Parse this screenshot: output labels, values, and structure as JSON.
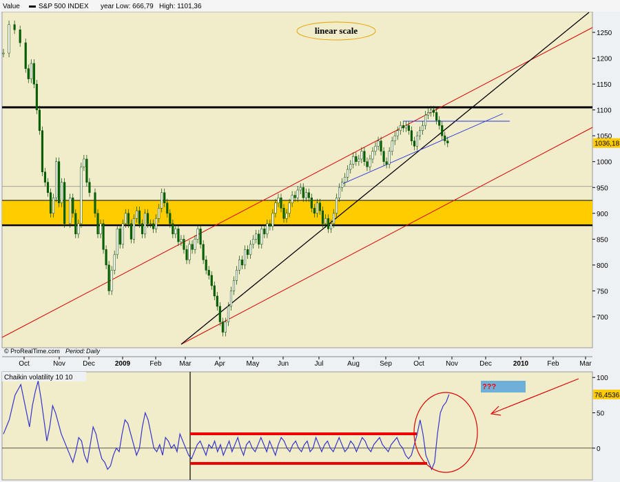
{
  "header": {
    "value_label": "Value",
    "series_name": "S&P 500 INDEX",
    "year_low_label": "year Low: 666,79",
    "high_label": "High: 1101,36"
  },
  "annotations": {
    "scale_note": "linear scale",
    "question": "???",
    "source": "© ProRealTime.com",
    "period_label": "Period:",
    "period_value": "Daily"
  },
  "colors": {
    "panel_bg": "#f1ecca",
    "band": "#ffcc00",
    "price": "#006600",
    "channel": "#dd0000",
    "trend": "#000000",
    "volatility": "#3333cc",
    "value_box": "#ffcc00"
  },
  "chart_data": [
    {
      "type": "line",
      "series": [
        {
          "name": "S&P 500 INDEX"
        }
      ],
      "x_ticks": [
        "Oct",
        "Nov",
        "Dec",
        "2009",
        "Feb",
        "Mar",
        "Apr",
        "May",
        "Jun",
        "Jul",
        "Aug",
        "Sep",
        "Oct",
        "Nov",
        "Dec",
        "2010",
        "Feb",
        "Mar"
      ],
      "y_ticks": [
        700,
        750,
        800,
        850,
        900,
        950,
        1000,
        1050,
        1100,
        1150,
        1200,
        1250
      ],
      "ylim": [
        640,
        1290
      ],
      "last_value": "1036,18",
      "resistance_level": 1105,
      "support_band": [
        877,
        925
      ],
      "reference_level": 952,
      "points": [
        [
          0,
          1210
        ],
        [
          2,
          1265
        ],
        [
          4,
          1255
        ],
        [
          6,
          1230
        ],
        [
          8,
          1180
        ],
        [
          9,
          1160
        ],
        [
          10,
          1190
        ],
        [
          11,
          1150
        ],
        [
          12,
          1100
        ],
        [
          13,
          1060
        ],
        [
          14,
          980
        ],
        [
          15,
          960
        ],
        [
          16,
          940
        ],
        [
          17,
          900
        ],
        [
          18,
          930
        ],
        [
          19,
          1000
        ],
        [
          20,
          920
        ],
        [
          21,
          960
        ],
        [
          22,
          880
        ],
        [
          24,
          930
        ],
        [
          25,
          900
        ],
        [
          26,
          860
        ],
        [
          27,
          880
        ],
        [
          28,
          990
        ],
        [
          29,
          1005
        ],
        [
          30,
          960
        ],
        [
          31,
          940
        ],
        [
          33,
          900
        ],
        [
          34,
          860
        ],
        [
          35,
          880
        ],
        [
          36,
          830
        ],
        [
          37,
          800
        ],
        [
          38,
          750
        ],
        [
          39,
          790
        ],
        [
          40,
          820
        ],
        [
          41,
          870
        ],
        [
          42,
          840
        ],
        [
          43,
          880
        ],
        [
          44,
          900
        ],
        [
          45,
          880
        ],
        [
          46,
          850
        ],
        [
          47,
          890
        ],
        [
          48,
          905
        ],
        [
          49,
          880
        ],
        [
          50,
          860
        ],
        [
          51,
          900
        ],
        [
          52,
          880
        ],
        [
          53,
          880
        ],
        [
          54,
          870
        ],
        [
          55,
          890
        ],
        [
          56,
          910
        ],
        [
          57,
          940
        ],
        [
          58,
          920
        ],
        [
          59,
          900
        ],
        [
          60,
          880
        ],
        [
          61,
          860
        ],
        [
          62,
          870
        ],
        [
          63,
          845
        ],
        [
          64,
          850
        ],
        [
          65,
          830
        ],
        [
          66,
          810
        ],
        [
          67,
          840
        ],
        [
          68,
          830
        ],
        [
          69,
          850
        ],
        [
          70,
          870
        ],
        [
          71,
          840
        ],
        [
          72,
          810
        ],
        [
          73,
          790
        ],
        [
          74,
          780
        ],
        [
          75,
          760
        ],
        [
          76,
          740
        ],
        [
          77,
          720
        ],
        [
          78,
          690
        ],
        [
          79,
          670
        ],
        [
          80,
          690
        ],
        [
          81,
          720
        ],
        [
          82,
          750
        ],
        [
          83,
          770
        ],
        [
          84,
          790
        ],
        [
          85,
          810
        ],
        [
          86,
          800
        ],
        [
          87,
          830
        ],
        [
          88,
          820
        ],
        [
          89,
          840
        ],
        [
          90,
          850
        ],
        [
          91,
          860
        ],
        [
          92,
          840
        ],
        [
          93,
          870
        ],
        [
          94,
          860
        ],
        [
          95,
          880
        ],
        [
          96,
          875
        ],
        [
          97,
          900
        ],
        [
          98,
          920
        ],
        [
          99,
          930
        ],
        [
          100,
          910
        ],
        [
          101,
          890
        ],
        [
          102,
          900
        ],
        [
          103,
          920
        ],
        [
          104,
          935
        ],
        [
          105,
          930
        ],
        [
          106,
          945
        ],
        [
          107,
          950
        ],
        [
          108,
          930
        ],
        [
          109,
          940
        ],
        [
          110,
          930
        ],
        [
          111,
          910
        ],
        [
          112,
          900
        ],
        [
          113,
          920
        ],
        [
          114,
          905
        ],
        [
          115,
          880
        ],
        [
          116,
          890
        ],
        [
          117,
          870
        ],
        [
          118,
          880
        ],
        [
          119,
          900
        ],
        [
          120,
          930
        ],
        [
          121,
          950
        ],
        [
          122,
          960
        ],
        [
          123,
          970
        ],
        [
          124,
          985
        ],
        [
          125,
          995
        ],
        [
          126,
          1010
        ],
        [
          127,
          1000
        ],
        [
          128,
          1005
        ],
        [
          129,
          1020
        ],
        [
          130,
          1000
        ],
        [
          131,
          990
        ],
        [
          132,
          1005
        ],
        [
          133,
          1020
        ],
        [
          134,
          1030
        ],
        [
          135,
          1040
        ],
        [
          136,
          1020
        ],
        [
          137,
          1000
        ],
        [
          138,
          995
        ],
        [
          139,
          1020
        ],
        [
          140,
          1040
        ],
        [
          141,
          1050
        ],
        [
          142,
          1060
        ],
        [
          143,
          1070
        ],
        [
          144,
          1065
        ],
        [
          145,
          1070
        ],
        [
          146,
          1060
        ],
        [
          147,
          1040
        ],
        [
          148,
          1030
        ],
        [
          149,
          1050
        ],
        [
          150,
          1060
        ],
        [
          151,
          1070
        ],
        [
          152,
          1090
        ],
        [
          153,
          1095
        ],
        [
          154,
          1100
        ],
        [
          155,
          1095
        ],
        [
          156,
          1080
        ],
        [
          157,
          1070
        ],
        [
          158,
          1050
        ],
        [
          159,
          1040
        ],
        [
          160,
          1036
        ]
      ]
    },
    {
      "type": "line",
      "title": "Chaikin volatility 10 10",
      "series": [
        {
          "name": "Chaikin volatility 10 10"
        }
      ],
      "y_ticks": [
        0,
        50,
        100
      ],
      "ylim": [
        -45,
        108
      ],
      "last_value": "76,4536",
      "points": [
        [
          0,
          20
        ],
        [
          2,
          40
        ],
        [
          4,
          75
        ],
        [
          6,
          90
        ],
        [
          8,
          50
        ],
        [
          9,
          30
        ],
        [
          10,
          60
        ],
        [
          11,
          80
        ],
        [
          12,
          95
        ],
        [
          13,
          70
        ],
        [
          14,
          40
        ],
        [
          15,
          10
        ],
        [
          16,
          30
        ],
        [
          17,
          60
        ],
        [
          18,
          50
        ],
        [
          19,
          35
        ],
        [
          20,
          20
        ],
        [
          21,
          10
        ],
        [
          22,
          0
        ],
        [
          23,
          -10
        ],
        [
          24,
          -20
        ],
        [
          25,
          -5
        ],
        [
          26,
          15
        ],
        [
          27,
          10
        ],
        [
          28,
          -10
        ],
        [
          29,
          -20
        ],
        [
          30,
          5
        ],
        [
          31,
          30
        ],
        [
          32,
          20
        ],
        [
          33,
          0
        ],
        [
          34,
          -15
        ],
        [
          35,
          -20
        ],
        [
          36,
          -30
        ],
        [
          37,
          -25
        ],
        [
          38,
          -10
        ],
        [
          39,
          0
        ],
        [
          40,
          -5
        ],
        [
          41,
          20
        ],
        [
          42,
          40
        ],
        [
          43,
          35
        ],
        [
          44,
          20
        ],
        [
          45,
          5
        ],
        [
          46,
          -10
        ],
        [
          47,
          0
        ],
        [
          48,
          30
        ],
        [
          49,
          50
        ],
        [
          50,
          40
        ],
        [
          51,
          20
        ],
        [
          52,
          0
        ],
        [
          53,
          -5
        ],
        [
          54,
          5
        ],
        [
          55,
          -10
        ],
        [
          56,
          15
        ],
        [
          57,
          10
        ],
        [
          58,
          0
        ],
        [
          59,
          5
        ],
        [
          60,
          -5
        ],
        [
          61,
          20
        ],
        [
          62,
          10
        ],
        [
          63,
          0
        ],
        [
          64,
          -10
        ],
        [
          65,
          -15
        ],
        [
          66,
          -5
        ],
        [
          67,
          5
        ],
        [
          68,
          10
        ],
        [
          69,
          0
        ],
        [
          70,
          -10
        ],
        [
          71,
          5
        ],
        [
          72,
          0
        ],
        [
          73,
          10
        ],
        [
          74,
          -5
        ],
        [
          75,
          5
        ],
        [
          76,
          -10
        ],
        [
          77,
          0
        ],
        [
          78,
          10
        ],
        [
          79,
          -5
        ],
        [
          80,
          5
        ],
        [
          81,
          15
        ],
        [
          82,
          0
        ],
        [
          83,
          -10
        ],
        [
          84,
          5
        ],
        [
          85,
          10
        ],
        [
          86,
          0
        ],
        [
          87,
          -5
        ],
        [
          88,
          5
        ],
        [
          89,
          15
        ],
        [
          90,
          5
        ],
        [
          91,
          -5
        ],
        [
          92,
          10
        ],
        [
          93,
          0
        ],
        [
          94,
          -10
        ],
        [
          95,
          5
        ],
        [
          96,
          15
        ],
        [
          97,
          10
        ],
        [
          98,
          0
        ],
        [
          99,
          -5
        ],
        [
          100,
          5
        ],
        [
          101,
          10
        ],
        [
          102,
          0
        ],
        [
          103,
          -5
        ],
        [
          104,
          5
        ],
        [
          105,
          10
        ],
        [
          106,
          -5
        ],
        [
          107,
          0
        ],
        [
          108,
          15
        ],
        [
          109,
          5
        ],
        [
          110,
          -5
        ],
        [
          111,
          5
        ],
        [
          112,
          10
        ],
        [
          113,
          0
        ],
        [
          114,
          -5
        ],
        [
          115,
          5
        ],
        [
          116,
          15
        ],
        [
          117,
          5
        ],
        [
          118,
          -5
        ],
        [
          119,
          0
        ],
        [
          120,
          10
        ],
        [
          121,
          5
        ],
        [
          122,
          -5
        ],
        [
          123,
          5
        ],
        [
          124,
          15
        ],
        [
          125,
          10
        ],
        [
          126,
          0
        ],
        [
          127,
          -5
        ],
        [
          128,
          5
        ],
        [
          129,
          10
        ],
        [
          130,
          15
        ],
        [
          131,
          5
        ],
        [
          132,
          0
        ],
        [
          133,
          -5
        ],
        [
          134,
          5
        ],
        [
          135,
          10
        ],
        [
          136,
          15
        ],
        [
          137,
          5
        ],
        [
          138,
          0
        ],
        [
          139,
          -10
        ],
        [
          140,
          -15
        ],
        [
          141,
          -10
        ],
        [
          142,
          5
        ],
        [
          143,
          20
        ],
        [
          144,
          40
        ],
        [
          145,
          20
        ],
        [
          146,
          -10
        ],
        [
          147,
          -20
        ],
        [
          148,
          -30
        ],
        [
          149,
          -20
        ],
        [
          150,
          20
        ],
        [
          151,
          50
        ],
        [
          152,
          60
        ],
        [
          153,
          65
        ],
        [
          154,
          76
        ]
      ]
    }
  ]
}
